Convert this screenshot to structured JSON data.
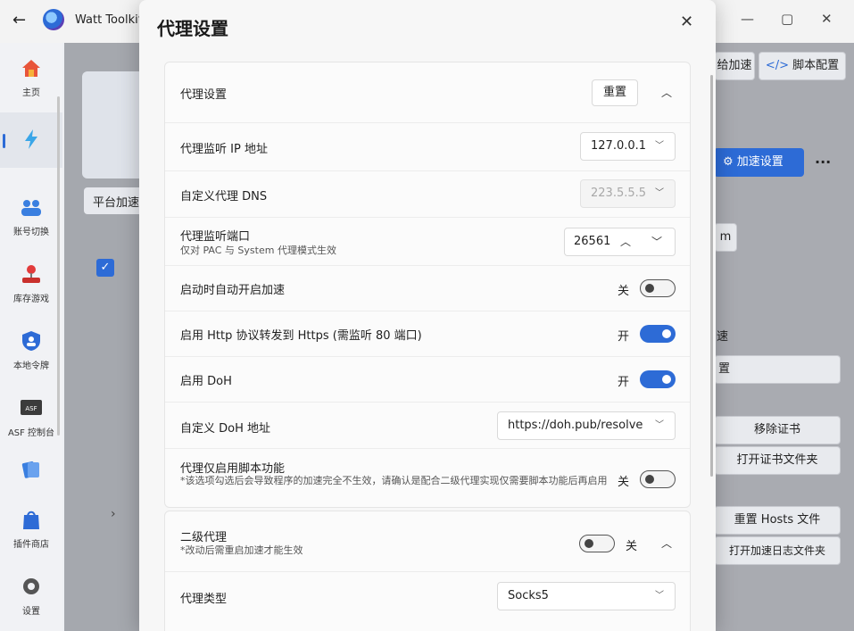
{
  "app": {
    "title": "Watt Toolkit",
    "back_icon": "back-arrow-icon",
    "window_controls": [
      "—",
      "▢",
      "✕"
    ]
  },
  "sidebar": {
    "items": [
      {
        "label": "主页",
        "icon": "home-icon"
      },
      {
        "label": "",
        "icon": "lightning-icon"
      },
      {
        "label": "账号切换",
        "icon": "account-switch-icon"
      },
      {
        "label": "库存游戏",
        "icon": "joystick-icon"
      },
      {
        "label": "本地令牌",
        "icon": "shield-icon"
      },
      {
        "label": "ASF 控制台",
        "icon": "asf-icon"
      },
      {
        "label": "",
        "icon": "cards-icon"
      },
      {
        "label": "插件商店",
        "icon": "shopping-bag-icon"
      },
      {
        "label": "设置",
        "icon": "gear-icon"
      }
    ]
  },
  "background": {
    "tab_label": "平台加速",
    "top_tab_accel": "给加速",
    "top_tab_script": "脚本配置",
    "accel_settings": "加速设置",
    "more": "···",
    "fragment_m": "m",
    "fragment_speed": "速",
    "fragment_settings": "置",
    "remove_cert": "移除证书",
    "open_cert_folder": "打开证书文件夹",
    "reset_hosts": "重置 Hosts 文件",
    "open_log_folder": "打开加速日志文件夹",
    "check_mark": "✓",
    "chevron": "›"
  },
  "dialog": {
    "title": "代理设置",
    "close": "✕",
    "proxy_panel": {
      "header": "代理设置",
      "reset_label": "重置",
      "expand": "︿",
      "rows": {
        "listen_ip": {
          "label": "代理监听 IP 地址",
          "value": "127.0.0.1"
        },
        "custom_dns": {
          "label": "自定义代理 DNS",
          "value": "223.5.5.5"
        },
        "listen_port": {
          "label": "代理监听端口",
          "sub": "仅对 PAC 与 System 代理模式生效",
          "value": "26561"
        },
        "auto_start": {
          "label": "启动时自动开启加速",
          "state": "关",
          "on": false
        },
        "http_forward": {
          "label": "启用 Http 协议转发到 Https (需监听 80 端口)",
          "state": "开",
          "on": true
        },
        "doh": {
          "label": "启用 DoH",
          "state": "开",
          "on": true
        },
        "doh_address": {
          "label": "自定义 DoH 地址",
          "value": "https://doh.pub/resolve"
        },
        "script_only": {
          "label": "代理仅启用脚本功能",
          "sub": "*该选项勾选后会导致程序的加速完全不生效，请确认是配合二级代理实现仅需要脚本功能后再启用",
          "state": "关",
          "on": false
        }
      }
    },
    "secondary_panel": {
      "header": "二级代理",
      "sub": "*改动后需重启加速才能生效",
      "state": "关",
      "on": false,
      "expand": "︿",
      "type_label": "代理类型",
      "type_value": "Socks5"
    }
  },
  "colors": {
    "accent": "#2d6bd6",
    "dialog_bg": "#f7f7f7",
    "panel_bg": "#fbfbfb"
  }
}
